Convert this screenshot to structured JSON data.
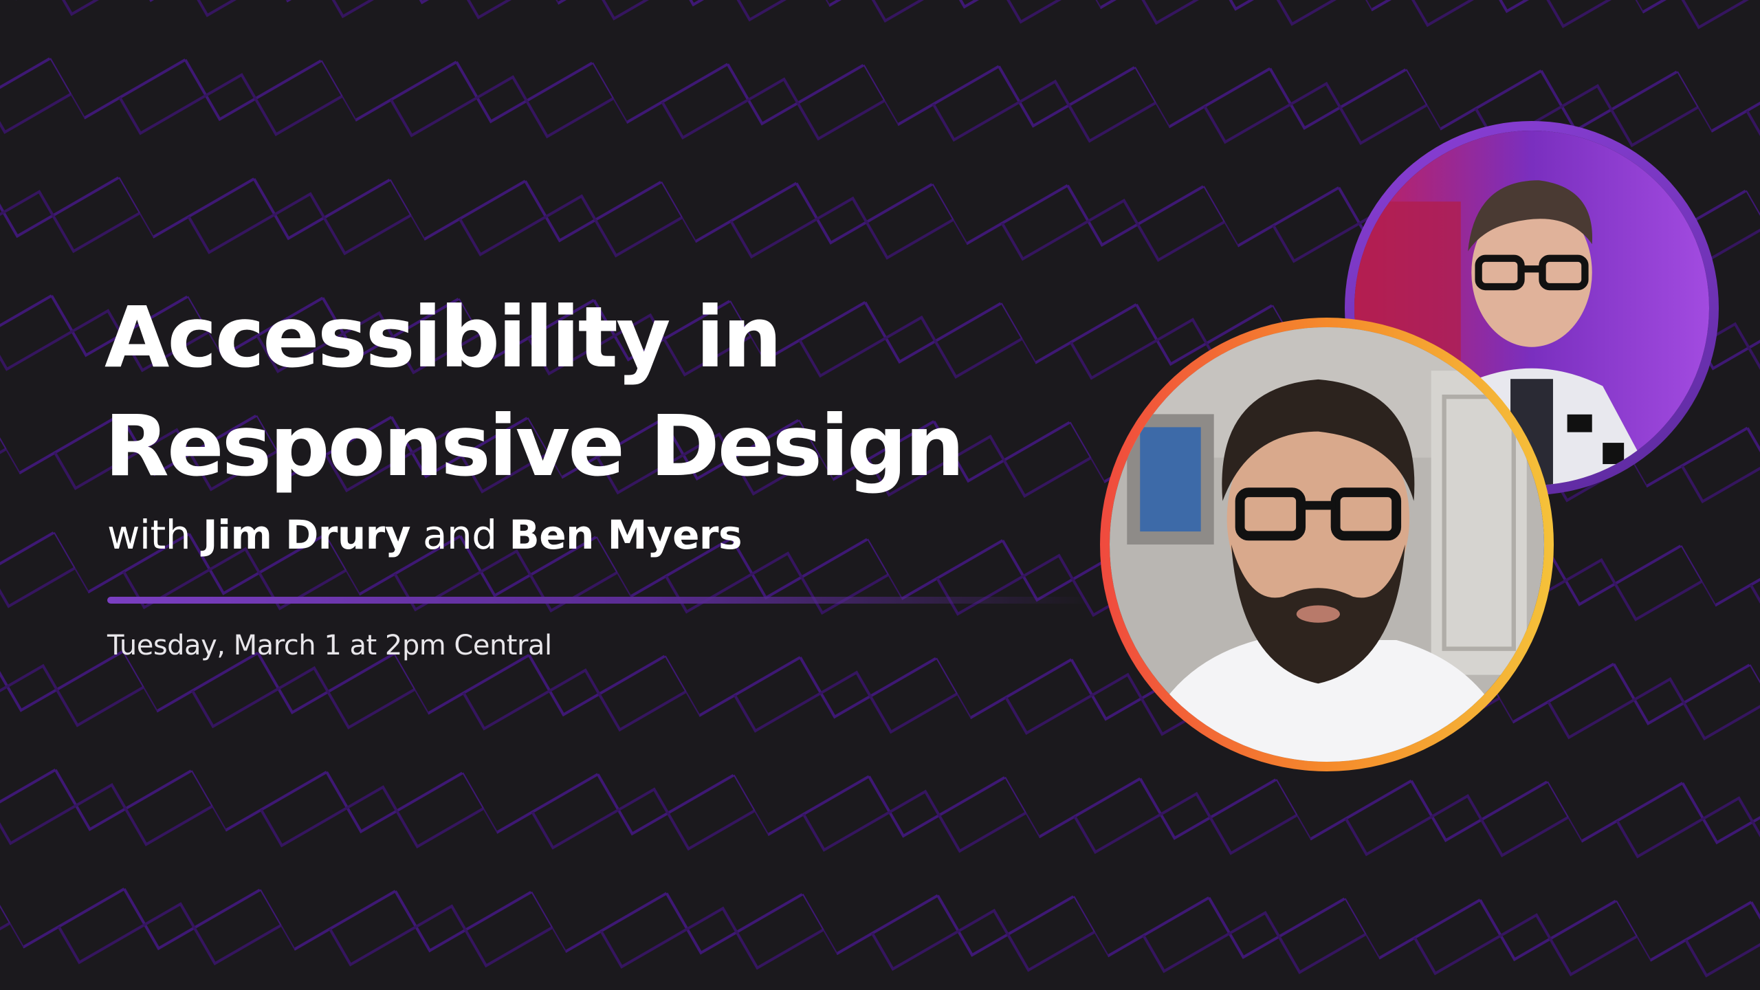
{
  "title": {
    "line1": "Accessibility in",
    "line2": "Responsive Design"
  },
  "hosts": {
    "prefix": "with",
    "host1": "Jim Drury",
    "conjunction": "and",
    "host2": "Ben Myers"
  },
  "date": "Tuesday, March 1 at 2pm Central",
  "colors": {
    "background": "#1b191d",
    "pattern_stroke": "#3e1874",
    "divider_start": "#7b3fc2",
    "divider_end": "#2a1540",
    "ring_purple_start": "#8a3fd6",
    "ring_purple_end": "#5c2a9e",
    "ring_warm_start": "#f04a3e",
    "ring_warm_mid": "#f58a2b",
    "ring_warm_end": "#f5c23a"
  },
  "avatars": [
    {
      "name": "ben-myers-photo",
      "ring": "purple"
    },
    {
      "name": "jim-drury-photo",
      "ring": "warm"
    }
  ]
}
